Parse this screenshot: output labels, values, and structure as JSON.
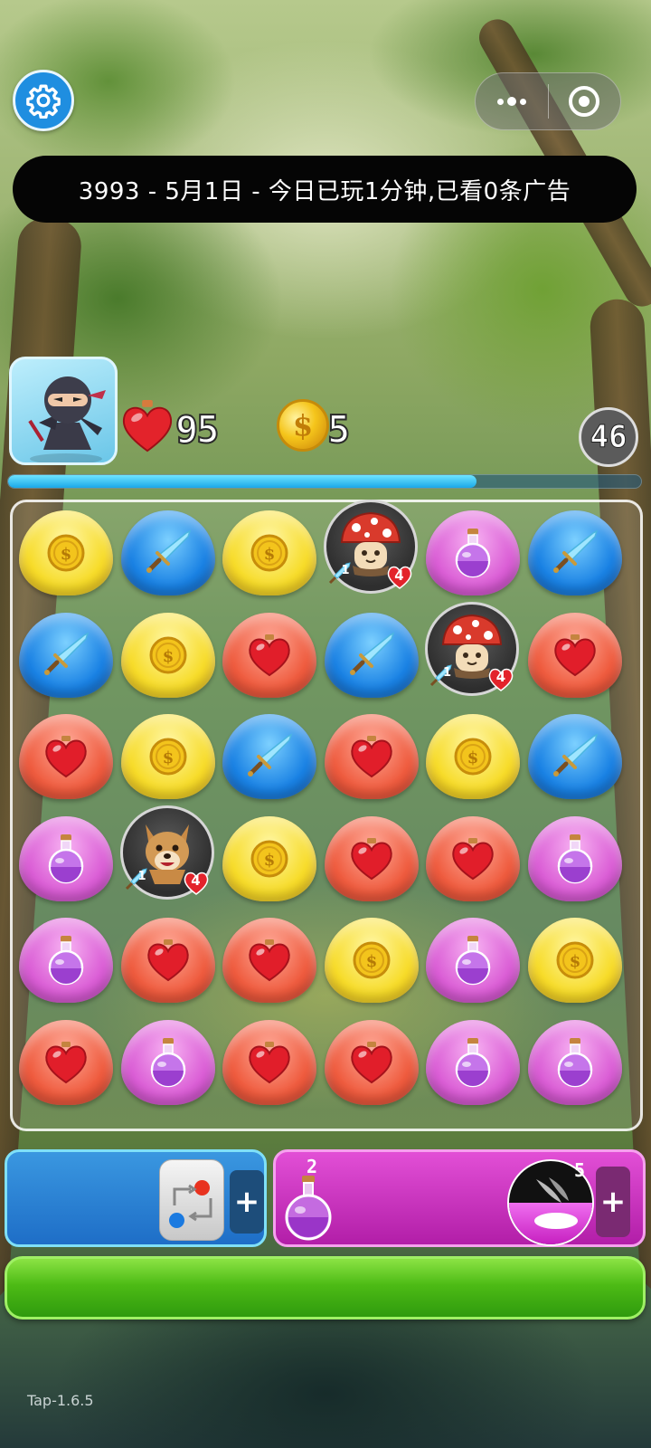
{
  "header": {
    "status_text": "3993 - 5月1日 - 今日已玩1分钟,已看0条广告"
  },
  "hud": {
    "health": "95",
    "coins": "5",
    "moves_left": "46",
    "progress_fraction": 0.74
  },
  "board": {
    "rows": 6,
    "cols": 6,
    "grid": [
      [
        "coin",
        "sword",
        "coin",
        "enemy-mushroom",
        "potion",
        "sword"
      ],
      [
        "sword",
        "coin",
        "heart",
        "sword",
        "enemy-mushroom",
        "heart"
      ],
      [
        "heart",
        "coin",
        "sword",
        "heart",
        "coin",
        "sword"
      ],
      [
        "potion",
        "enemy-wolf",
        "coin",
        "heart",
        "heart",
        "potion"
      ],
      [
        "potion",
        "heart",
        "heart",
        "coin",
        "potion",
        "coin"
      ],
      [
        "heart",
        "potion",
        "heart",
        "heart",
        "potion",
        "potion"
      ]
    ],
    "enemies": {
      "enemy-mushroom": {
        "attack": "1",
        "hp": "4"
      },
      "enemy-wolf": {
        "attack": "1",
        "hp": "4"
      }
    }
  },
  "items": {
    "potion_count": "2",
    "skill_count": "5",
    "plus_label": "+"
  },
  "footer": {
    "version": "Tap-1.6.5"
  },
  "colors": {
    "coin": "#f7dc2a",
    "sword": "#1a82e4",
    "heart": "#ef5c3f",
    "potion": "#db5fd6",
    "action_button": "#4dbb15"
  }
}
